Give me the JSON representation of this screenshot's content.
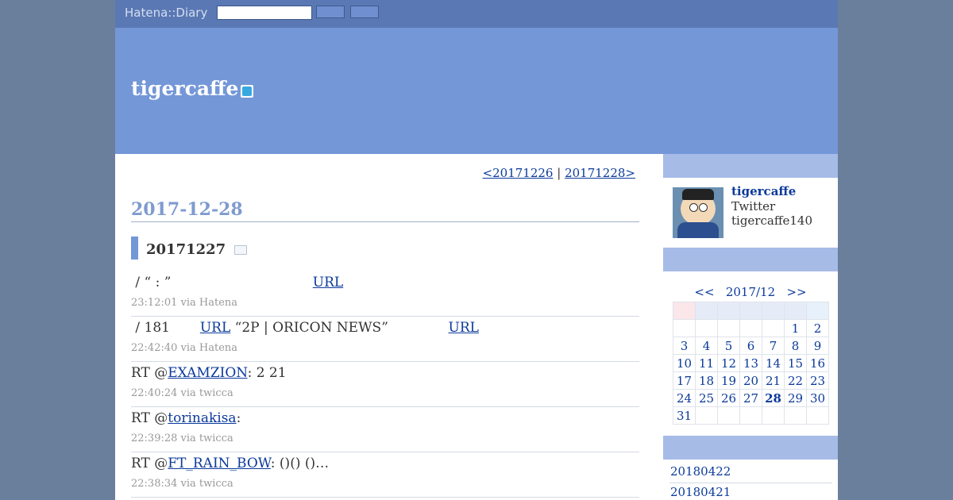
{
  "topbar": {
    "logo": "Hatena::Diary",
    "search_value": ""
  },
  "blog": {
    "title": "tigercaffe"
  },
  "pager": {
    "prev": "<20171226",
    "sep": " | ",
    "next": "20171228>"
  },
  "date": "2017-12-28",
  "section": {
    "title": "20171227"
  },
  "entries": [
    {
      "segments": [
        {
          "t": " / “ : ”                                 ",
          "link": false
        },
        {
          "t": "URL",
          "link": true
        }
      ],
      "meta": "23:12:01 via Hatena"
    },
    {
      "segments": [
        {
          "t": " / 181       ",
          "link": false
        },
        {
          "t": "URL",
          "link": true
        },
        {
          "t": " “2P | ORICON NEWS”              ",
          "link": false
        },
        {
          "t": "URL",
          "link": true
        }
      ],
      "meta": "22:42:40 via Hatena"
    },
    {
      "segments": [
        {
          "t": "RT @",
          "link": false
        },
        {
          "t": "EXAMZION",
          "link": true
        },
        {
          "t": ": 2 21",
          "link": false
        }
      ],
      "meta": "22:40:24 via twicca"
    },
    {
      "segments": [
        {
          "t": "RT @",
          "link": false
        },
        {
          "t": "torinakisa",
          "link": true
        },
        {
          "t": ":",
          "link": false
        }
      ],
      "meta": "22:39:28 via twicca"
    },
    {
      "segments": [
        {
          "t": "RT @",
          "link": false
        },
        {
          "t": "FT_RAIN_BOW",
          "link": true
        },
        {
          "t": ": ()() ()…",
          "link": false
        }
      ],
      "meta": "22:38:34 via twicca"
    }
  ],
  "profile": {
    "name": "tigercaffe",
    "line1": "Twitter",
    "line2": "tigercaffe140"
  },
  "calendar": {
    "prev": "<<",
    "month": "2017/12",
    "next": ">>",
    "today": "28",
    "weeks": [
      [
        "",
        "",
        "",
        "",
        "",
        "1",
        "2"
      ],
      [
        "3",
        "4",
        "5",
        "6",
        "7",
        "8",
        "9"
      ],
      [
        "10",
        "11",
        "12",
        "13",
        "14",
        "15",
        "16"
      ],
      [
        "17",
        "18",
        "19",
        "20",
        "21",
        "22",
        "23"
      ],
      [
        "24",
        "25",
        "26",
        "27",
        "28",
        "29",
        "30"
      ],
      [
        "31",
        "",
        "",
        "",
        "",
        "",
        ""
      ]
    ]
  },
  "archive": [
    "20180422",
    "20180421"
  ],
  "colors": {
    "link": "#0b3a9b",
    "banner": "#7497d8",
    "topbar": "#5a78b3"
  }
}
